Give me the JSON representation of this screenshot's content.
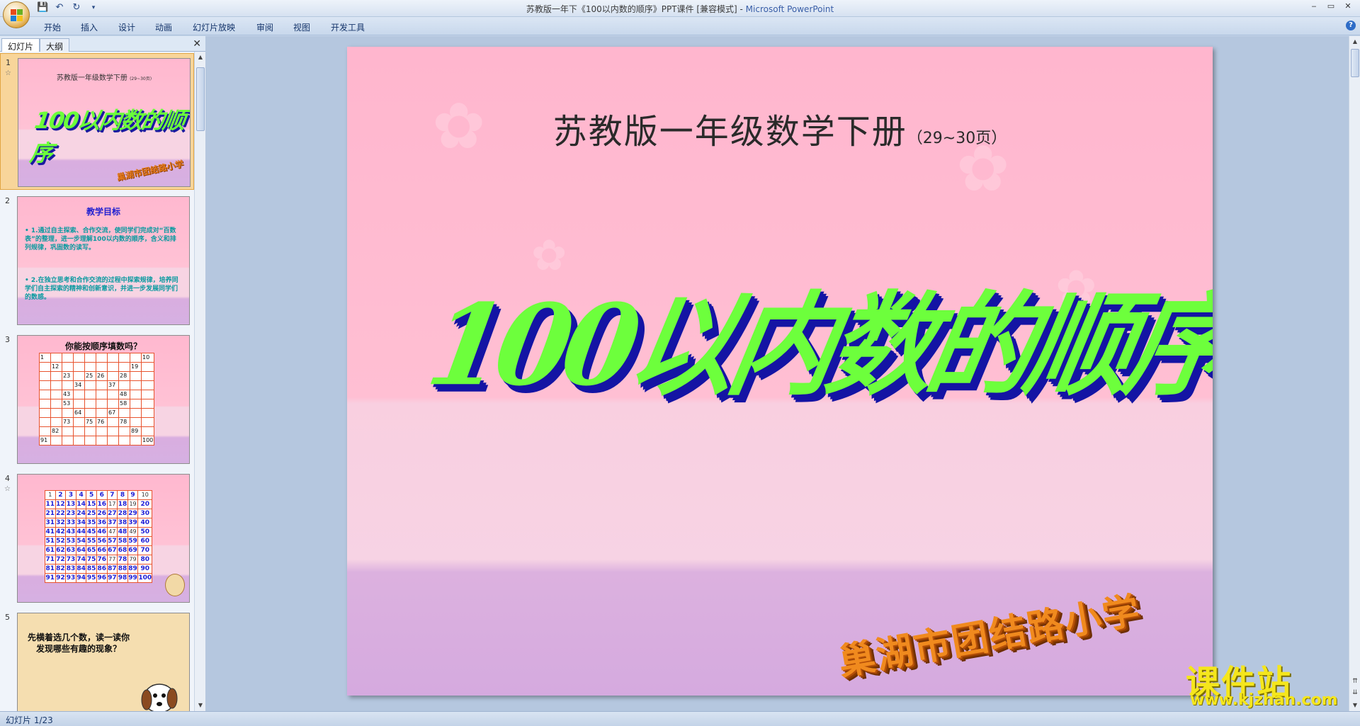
{
  "window": {
    "title_doc": "苏教版一年下《100以内数的顺序》PPT课件 [兼容模式]",
    "title_sep": " - ",
    "title_app": "Microsoft PowerPoint",
    "controls": [
      "‒",
      "▭",
      "✕"
    ]
  },
  "quick_access": [
    "save-icon",
    "undo-icon",
    "redo-icon",
    "customize-icon"
  ],
  "ribbon": {
    "tabs": [
      "开始",
      "插入",
      "设计",
      "动画",
      "幻灯片放映",
      "审阅",
      "视图",
      "开发工具"
    ],
    "help": "?"
  },
  "left_pane": {
    "tabs": [
      "幻灯片",
      "大纲"
    ],
    "close": "✕",
    "slides": [
      {
        "num": "1",
        "subtitle": "苏教版一年级数学下册",
        "pages": "(29~30页)",
        "title": "100以内数的顺序",
        "school": "巢湖市团结路小学"
      },
      {
        "num": "2",
        "title": "教学目标",
        "p1": "• 1.通过自主探索、合作交流，使同学们完成对“百数表”的整理，进一步理解100以内数的顺序，含义和排列规律，巩固数的读写。",
        "p2": "• 2.在独立思考和合作交流的过程中探索规律，培养同学们自主探索的精神和创新意识，并进一步发展同学们的数感。"
      },
      {
        "num": "3",
        "title": "你能按顺序填数吗？"
      },
      {
        "num": "4"
      },
      {
        "num": "5",
        "text_line1": "先横着选几个数，读一读你",
        "text_line2": "发现哪些有趣的现象？"
      }
    ],
    "grid3": [
      [
        "1",
        "",
        "",
        "",
        "",
        "",
        "",
        "",
        "",
        "10"
      ],
      [
        "",
        "12",
        "",
        "",
        "",
        "",
        "",
        "",
        "19",
        ""
      ],
      [
        "",
        "",
        "23",
        "",
        "25",
        "26",
        "",
        "28",
        "",
        ""
      ],
      [
        "",
        "",
        "",
        "34",
        "",
        "",
        "37",
        "",
        "",
        ""
      ],
      [
        "",
        "",
        "43",
        "",
        "",
        "",
        "",
        "48",
        "",
        ""
      ],
      [
        "",
        "",
        "53",
        "",
        "",
        "",
        "",
        "58",
        "",
        ""
      ],
      [
        "",
        "",
        "",
        "64",
        "",
        "",
        "67",
        "",
        "",
        ""
      ],
      [
        "",
        "",
        "73",
        "",
        "75",
        "76",
        "",
        "78",
        "",
        ""
      ],
      [
        "",
        "82",
        "",
        "",
        "",
        "",
        "",
        "",
        "89",
        ""
      ],
      [
        "91",
        "",
        "",
        "",
        "",
        "",
        "",
        "",
        "",
        "100"
      ]
    ]
  },
  "slide": {
    "subtitle": "苏教版一年级数学下册",
    "pages": "（29~30页）",
    "title": "100以内数的顺序",
    "school": "巢湖市团结路小学"
  },
  "watermark": {
    "cn": "课件站",
    "url": "www.kjzhan.com"
  },
  "status": {
    "slide_info": "幻灯片 1/23"
  }
}
